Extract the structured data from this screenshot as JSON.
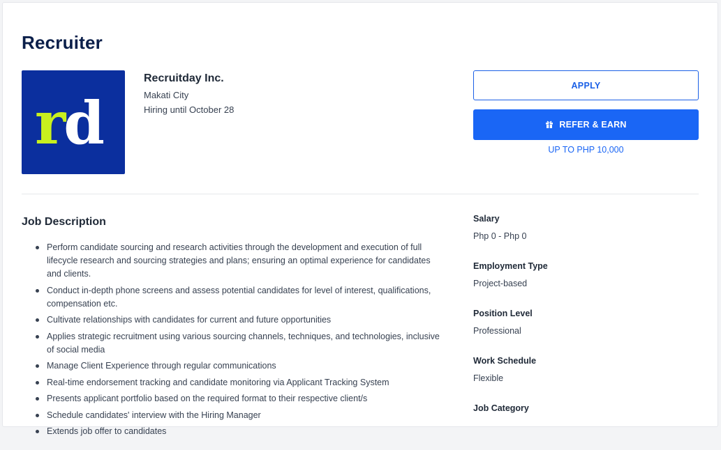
{
  "job": {
    "title": "Recruiter"
  },
  "company": {
    "logo_text": "rd",
    "name": "Recruitday Inc.",
    "location": "Makati City",
    "hiring_until": "Hiring until October 28"
  },
  "actions": {
    "apply_label": "APPLY",
    "refer_label": "REFER & EARN",
    "refer_icon": "gift-icon",
    "refer_note": "UP TO PHP 10,000"
  },
  "description": {
    "heading": "Job Description",
    "items": [
      "Perform candidate sourcing and research activities through the development and execution of full lifecycle research and sourcing strategies and plans; ensuring an optimal experience for candidates and clients.",
      "Conduct in-depth phone screens and assess potential candidates for level of interest, qualifications, compensation etc.",
      "Cultivate relationships with candidates for current and future opportunities",
      "Applies strategic recruitment using various sourcing channels, techniques, and technologies, inclusive of social media",
      "Manage Client Experience through regular communications",
      "Real-time endorsement tracking and candidate monitoring via Applicant Tracking System",
      "Presents applicant portfolio based on the required format to their respective client/s",
      "Schedule candidates' interview with the Hiring Manager",
      "Extends job offer to candidates"
    ]
  },
  "details": [
    {
      "label": "Salary",
      "value": "Php 0 - Php 0"
    },
    {
      "label": "Employment Type",
      "value": "Project-based"
    },
    {
      "label": "Position Level",
      "value": "Professional"
    },
    {
      "label": "Work Schedule",
      "value": "Flexible"
    },
    {
      "label": "Job Category",
      "value": ""
    }
  ],
  "colors": {
    "brand_blue": "#1a66f5",
    "title_navy": "#0b1f4a",
    "logo_bg": "#0b2f9e",
    "logo_accent": "#c8f01e"
  }
}
